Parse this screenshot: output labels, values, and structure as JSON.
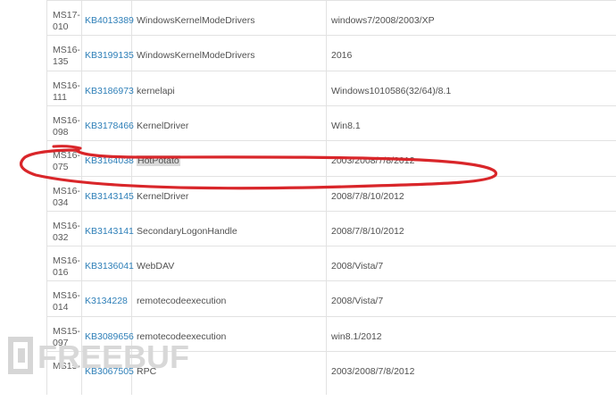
{
  "top_fragment": "...",
  "rows": [
    {
      "id": "MS17-\n010",
      "kb": "KB4013389",
      "desc": "WindowsKernelModeDrivers",
      "os": "windows7/2008/2003/XP"
    },
    {
      "id": "MS16-\n135",
      "kb": "KB3199135",
      "desc": "WindowsKernelModeDrivers",
      "os": "2016"
    },
    {
      "id": "MS16-\n111",
      "kb": "KB3186973",
      "desc": "kernelapi",
      "os": "Windows1010586(32/64)/8.1"
    },
    {
      "id": "MS16-\n098",
      "kb": "KB3178466",
      "desc": "KernelDriver",
      "os": "Win8.1"
    },
    {
      "id": "MS16-\n075",
      "kb": "KB3164038",
      "desc": "HotPotato",
      "os": "2003/2008/7/8/2012"
    },
    {
      "id": "MS16-\n034",
      "kb": "KB3143145",
      "desc": "KernelDriver",
      "os": "2008/7/8/10/2012"
    },
    {
      "id": "MS16-\n032",
      "kb": "KB3143141",
      "desc": "SecondaryLogonHandle",
      "os": "2008/7/8/10/2012"
    },
    {
      "id": "MS16-\n016",
      "kb": "KB3136041",
      "desc": "WebDAV",
      "os": "2008/Vista/7"
    },
    {
      "id": "MS16-\n014",
      "kb": "K3134228",
      "desc": "remotecodeexecution",
      "os": "2008/Vista/7"
    },
    {
      "id": "MS15-\n097",
      "kb": "KB3089656",
      "desc": "remotecodeexecution",
      "os": "win8.1/2012"
    },
    {
      "id": "MS15-",
      "kb": "KB3067505",
      "desc": "RPC",
      "os": "2003/2008/7/8/2012"
    }
  ],
  "highlighted_row_index": 4,
  "watermark_text": "FREEBUF",
  "colors": {
    "link": "#2e7fb8",
    "annotation": "#d9262a",
    "watermark": "#cfcfcf",
    "grid": "#e2e2e2"
  }
}
